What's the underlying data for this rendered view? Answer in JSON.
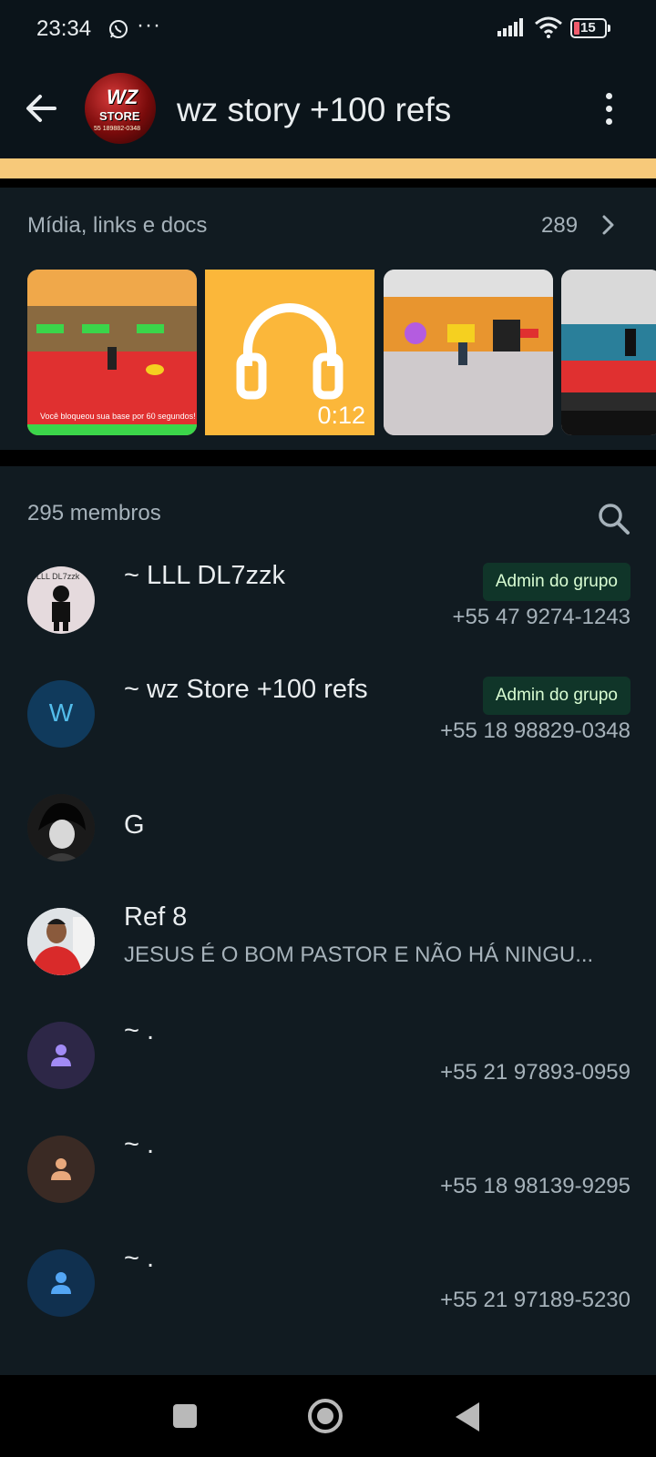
{
  "status_bar": {
    "time": "23:34",
    "dots": "···",
    "battery": "15",
    "icons": [
      "whatsapp-icon",
      "signal-icon",
      "wifi-icon",
      "battery-icon"
    ]
  },
  "header": {
    "title": "wz story +100 refs",
    "avatar_text": "WZ",
    "avatar_sub": "STORE",
    "avatar_phone": "55 189882-0348"
  },
  "media": {
    "title": "Mídia, links e docs",
    "count": "289",
    "items": [
      {
        "type": "image",
        "caption": "Você bloqueou sua base por 60 segundos!"
      },
      {
        "type": "audio",
        "duration": "0:12"
      },
      {
        "type": "image"
      },
      {
        "type": "image"
      }
    ]
  },
  "members": {
    "count_label": "295 membros",
    "list": [
      {
        "name": "~ LLL DL7zzk",
        "badge": "Admin do grupo",
        "phone": "+55 47 9274-1243",
        "avatar_text": "LLL DL7zzk"
      },
      {
        "name": "~ wz Store +100 refs",
        "badge": "Admin do grupo",
        "phone": "+55 18 98829-0348",
        "initial": "W"
      },
      {
        "name": "G"
      },
      {
        "name": "Ref 8",
        "about": "JESUS É O BOM PASTOR E NÃO HÁ NINGU..."
      },
      {
        "name": "~ .",
        "phone": "+55 21 97893-0959"
      },
      {
        "name": "~ .",
        "phone": "+55 18 98139-9295"
      },
      {
        "name": "~ .",
        "phone": "+55 21 97189-5230"
      }
    ]
  },
  "colors": {
    "background": "#0b141a",
    "panel": "#111b21",
    "accent_yellow": "#f7c97a",
    "admin_badge_bg": "#103529",
    "admin_badge_text": "#d9fdd3"
  }
}
